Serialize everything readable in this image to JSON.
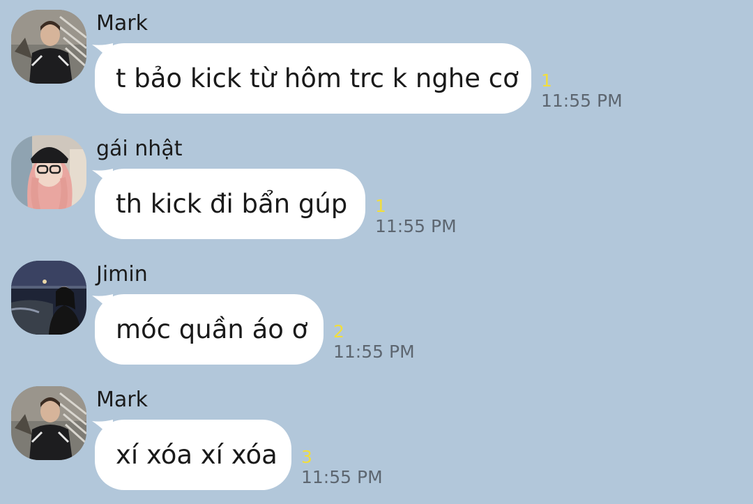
{
  "messages": [
    {
      "sender": "Mark",
      "text": "t bảo kick từ hôm trc k nghe cơ",
      "unread": "1",
      "time": "11:55 PM",
      "avatar": "mark-avatar"
    },
    {
      "sender": "gái nhật",
      "text": "th kick đi bẩn gúp",
      "unread": "1",
      "time": "11:55 PM",
      "avatar": "girl-avatar"
    },
    {
      "sender": "Jimin",
      "text": "móc quần áo ơ",
      "unread": "2",
      "time": "11:55 PM",
      "avatar": "jimin-avatar"
    },
    {
      "sender": "Mark",
      "text": "xí xóa xí xóa",
      "unread": "3",
      "time": "11:55 PM",
      "avatar": "mark-avatar"
    }
  ],
  "colors": {
    "background": "#b2c7da",
    "bubble": "#ffffff",
    "unread": "#f2de3b",
    "time": "#5d6670"
  }
}
